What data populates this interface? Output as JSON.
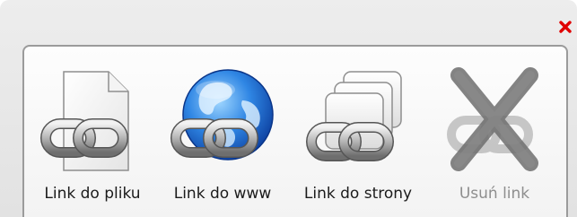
{
  "dialog": {
    "close_icon": "close-icon",
    "close_color": "#e00000"
  },
  "options": [
    {
      "label": "Link do pliku",
      "icon": "file-link-icon",
      "enabled": true
    },
    {
      "label": "Link do www",
      "icon": "globe-link-icon",
      "enabled": true
    },
    {
      "label": "Link do strony",
      "icon": "pages-link-icon",
      "enabled": true
    },
    {
      "label": "Usuń link",
      "icon": "remove-link-icon",
      "enabled": false
    }
  ]
}
